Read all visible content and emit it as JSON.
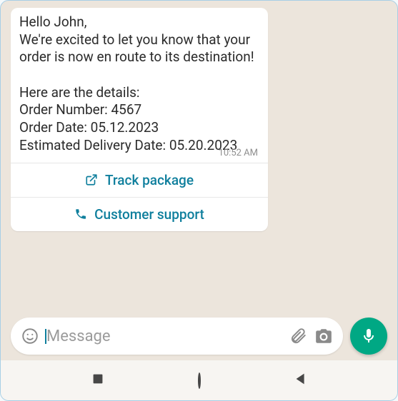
{
  "message": {
    "text": "Hello John,\nWe're excited to let you know that your order is now en route to its destination!\n\nHere are the details:\nOrder Number: 4567\nOrder Date: 05.12.2023\nEstimated Delivery Date: 05.20.2023",
    "timestamp": "10:52 AM",
    "actions": {
      "track": "Track package",
      "support": "Customer support"
    }
  },
  "input": {
    "placeholder": "Message"
  }
}
